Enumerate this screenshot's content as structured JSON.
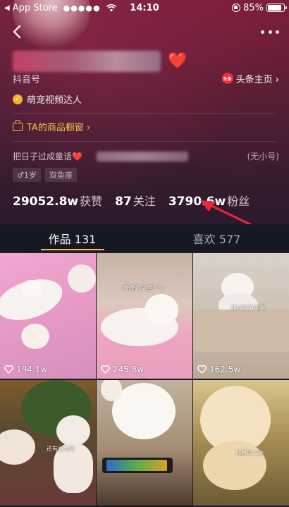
{
  "status_bar": {
    "back_app": "App Store",
    "signal": "●●●●●",
    "time": "14:10",
    "battery_percent": "85%",
    "battery_level": 0.85
  },
  "profile": {
    "heart": "❤️",
    "id_label": "抖音号",
    "toutiao_icon_text": "头条",
    "toutiao_link": "头条主页 ›",
    "badge": "萌宠视频达人",
    "shop": "TA的商品橱窗 ›",
    "bio": "把日子过成童话❤️",
    "bio_alt": "(无小号)",
    "tags": [
      "♂1岁",
      "双鱼座"
    ],
    "stats": [
      {
        "num": "29052.8w",
        "label": "获赞"
      },
      {
        "num": "87",
        "label": "关注"
      },
      {
        "num": "3790.6w",
        "label": "粉丝"
      }
    ]
  },
  "tabs": [
    {
      "label": "作品 131",
      "active": true
    },
    {
      "label": "喜欢 577",
      "active": false
    }
  ],
  "videos": [
    {
      "likes": "194.1w",
      "caption": ""
    },
    {
      "likes": "245.8w",
      "caption": "(酷酷的头型? ? )"
    },
    {
      "likes": "162.5w",
      "caption": "路过咪情况啊"
    },
    {
      "likes": "",
      "caption": "还有更大的"
    },
    {
      "likes": "",
      "caption": ""
    },
    {
      "likes": "",
      "caption": "你再说二遍"
    }
  ],
  "colors": {
    "accent": "#f5c04a",
    "background": "#161823",
    "annotation": "#e8283e"
  },
  "icons": {
    "back": "chevron-left-icon",
    "more": "more-dots-icon",
    "like": "heart-outline-icon"
  }
}
